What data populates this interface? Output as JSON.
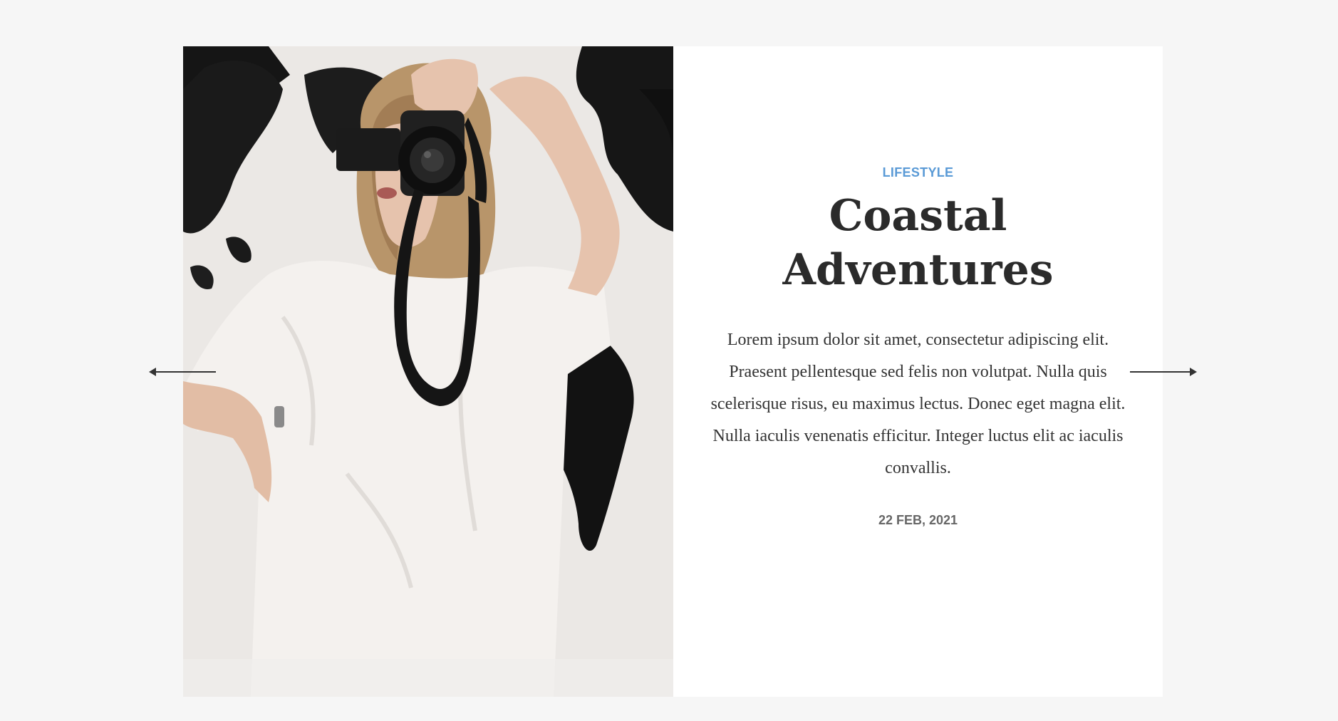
{
  "post": {
    "category": "LIFESTYLE",
    "title": "Coastal Adventures",
    "excerpt": "Lorem ipsum dolor sit amet, consectetur adipiscing elit. Praesent pellentesque sed felis non volutpat. Nulla quis scelerisque risus, eu maximus lectus. Donec eget magna elit. Nulla iaculis venenatis efficitur. Integer luctus elit ac iaculis convallis.",
    "date": "22 FEB, 2021"
  },
  "navigation": {
    "prev_icon": "arrow-left-icon",
    "next_icon": "arrow-right-icon"
  },
  "colors": {
    "page_background": "#f6f6f6",
    "card_background": "#ffffff",
    "category": "#5a9ad6",
    "title": "#2b2b2b",
    "text": "#333333",
    "date": "#666666"
  }
}
